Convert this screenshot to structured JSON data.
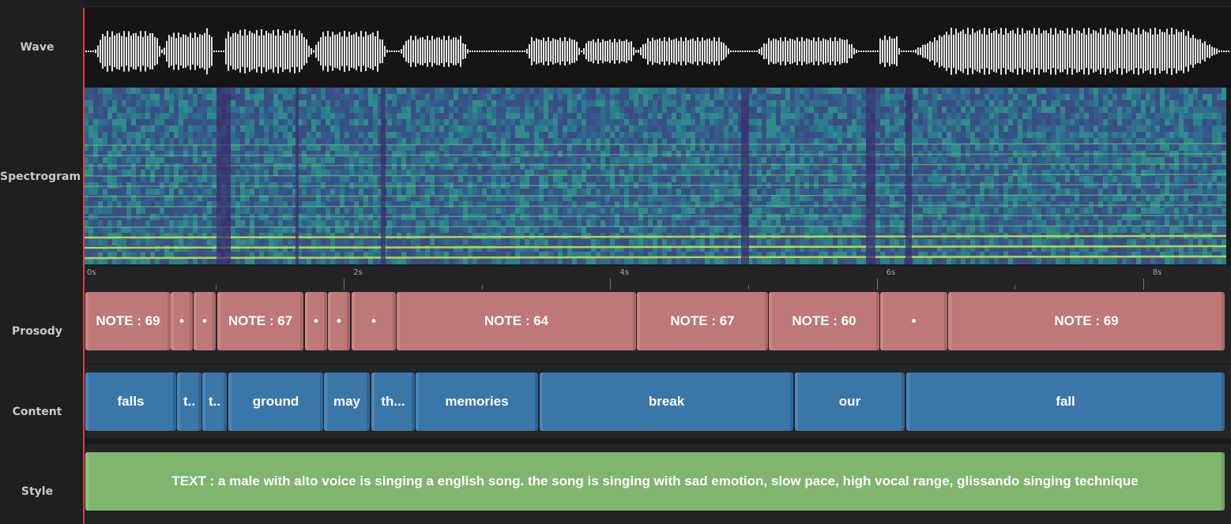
{
  "labels": {
    "wave": "Wave",
    "spectrogram": "Spectrogram",
    "prosody": "Prosody",
    "content": "Content",
    "style": "Style"
  },
  "axis": {
    "ticks": [
      "0s",
      "2s",
      "4s",
      "6s",
      "8s"
    ]
  },
  "prosody": [
    {
      "label": "NOTE : 69"
    },
    {
      "label": "•"
    },
    {
      "label": "•"
    },
    {
      "label": "NOTE : 67"
    },
    {
      "label": "•"
    },
    {
      "label": "•"
    },
    {
      "label": "•"
    },
    {
      "label": "NOTE : 64"
    },
    {
      "label": "NOTE : 67"
    },
    {
      "label": "NOTE : 60"
    },
    {
      "label": "•"
    },
    {
      "label": "NOTE : 69"
    }
  ],
  "content": [
    {
      "label": "falls"
    },
    {
      "label": "t.."
    },
    {
      "label": "t.."
    },
    {
      "label": "ground"
    },
    {
      "label": "may"
    },
    {
      "label": "th..."
    },
    {
      "label": "memories"
    },
    {
      "label": "break"
    },
    {
      "label": "our"
    },
    {
      "label": "fall"
    }
  ],
  "style": {
    "text": "TEXT : a male with alto voice is singing a english song. the song is singing with sad emotion, slow pace, high vocal range, glissando singing technique"
  },
  "colors": {
    "note": "#bd7877",
    "word": "#3b76a9",
    "style": "#7fb56d",
    "playhead": "#d9433e"
  }
}
